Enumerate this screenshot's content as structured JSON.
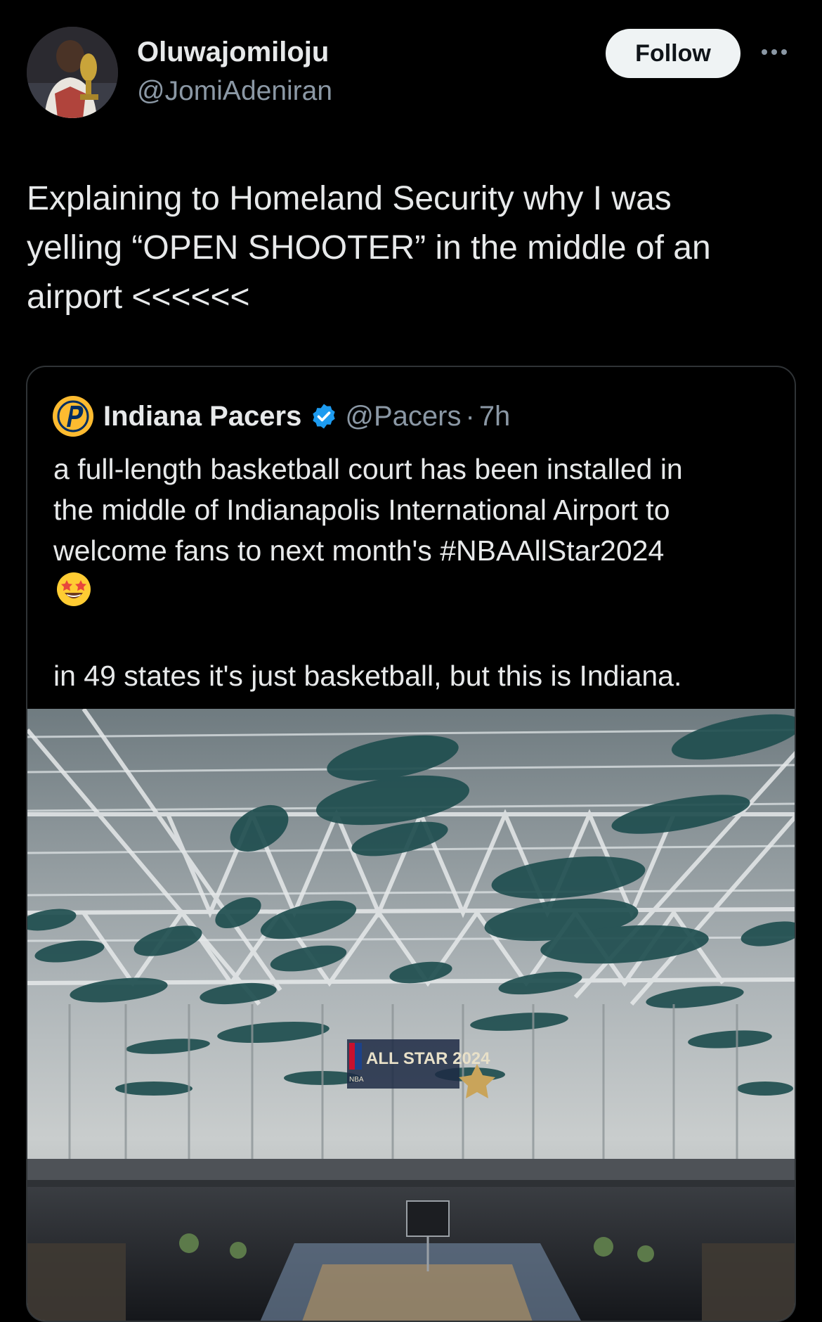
{
  "author": {
    "display_name": "Oluwajomiloju",
    "handle": "@JomiAdeniran"
  },
  "follow_label": "Follow",
  "tweet_text": "Explaining to Homeland Security why I was\nyelling “OPEN SHOOTER” in the middle of an\nairport <<<<<<",
  "quoted_tweet": {
    "display_name": "Indiana Pacers",
    "handle": "@Pacers",
    "separator": "·",
    "time": "7h",
    "text": "a full-length basketball court has been installed in\nthe middle of Indianapolis International Airport to\nwelcome fans to next month's #NBAAllStar2024",
    "emoji": "star-struck-emoji-icon",
    "text_2": "in 49 states it's just basketball, but this is Indiana.",
    "media": {
      "sign_text": "ALL STAR 2024",
      "sign_badge": "NBA"
    }
  },
  "colors": {
    "background": "#000000",
    "text": "#e7e9ea",
    "secondary": "#8b98a5",
    "verified": "#1d9bf0",
    "pacers_gold": "#fdbb30",
    "pacers_navy": "#002d62"
  }
}
